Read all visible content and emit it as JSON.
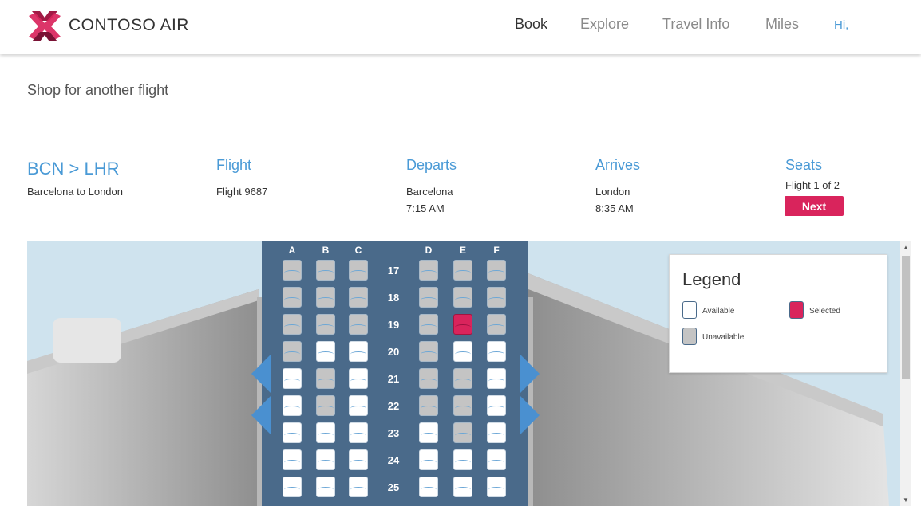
{
  "header": {
    "brand": "CONTOSO AIR",
    "nav": [
      "Book",
      "Explore",
      "Travel Info",
      "Miles"
    ],
    "greeting": "Hi,"
  },
  "shop_link": "Shop for another flight",
  "trip": {
    "route": "BCN > LHR",
    "route_sub": "Barcelona to London",
    "flight_title": "Flight",
    "flight_number": "Flight 9687",
    "departs_title": "Departs",
    "departs_city": "Barcelona",
    "departs_time": "7:15 AM",
    "arrives_title": "Arrives",
    "arrives_city": "London",
    "arrives_time": "8:35 AM",
    "seats_title": "Seats",
    "seats_progress": "Flight 1 of 2",
    "next_label": "Next"
  },
  "seatmap": {
    "columns": [
      "A",
      "B",
      "C",
      "D",
      "E",
      "F"
    ],
    "rows": [
      {
        "num": "17",
        "seats": [
          "unavailable",
          "unavailable",
          "unavailable",
          "unavailable",
          "unavailable",
          "unavailable"
        ]
      },
      {
        "num": "18",
        "seats": [
          "unavailable",
          "unavailable",
          "unavailable",
          "unavailable",
          "unavailable",
          "unavailable"
        ]
      },
      {
        "num": "19",
        "seats": [
          "unavailable",
          "unavailable",
          "unavailable",
          "unavailable",
          "selected",
          "unavailable"
        ]
      },
      {
        "num": "20",
        "seats": [
          "unavailable",
          "available",
          "available",
          "unavailable",
          "available",
          "available"
        ]
      },
      {
        "num": "21",
        "seats": [
          "available",
          "unavailable",
          "available",
          "unavailable",
          "unavailable",
          "available"
        ]
      },
      {
        "num": "22",
        "seats": [
          "available",
          "unavailable",
          "available",
          "unavailable",
          "unavailable",
          "available"
        ]
      },
      {
        "num": "23",
        "seats": [
          "available",
          "available",
          "available",
          "available",
          "unavailable",
          "available"
        ]
      },
      {
        "num": "24",
        "seats": [
          "available",
          "available",
          "available",
          "available",
          "available",
          "available"
        ]
      },
      {
        "num": "25",
        "seats": [
          "available",
          "available",
          "available",
          "available",
          "available",
          "available"
        ]
      }
    ]
  },
  "legend": {
    "title": "Legend",
    "available": "Available",
    "selected": "Selected",
    "unavailable": "Unavailable"
  },
  "colors": {
    "accent": "#4a9ad6",
    "selected": "#d9245c",
    "fuselage": "#4a6a8a"
  }
}
